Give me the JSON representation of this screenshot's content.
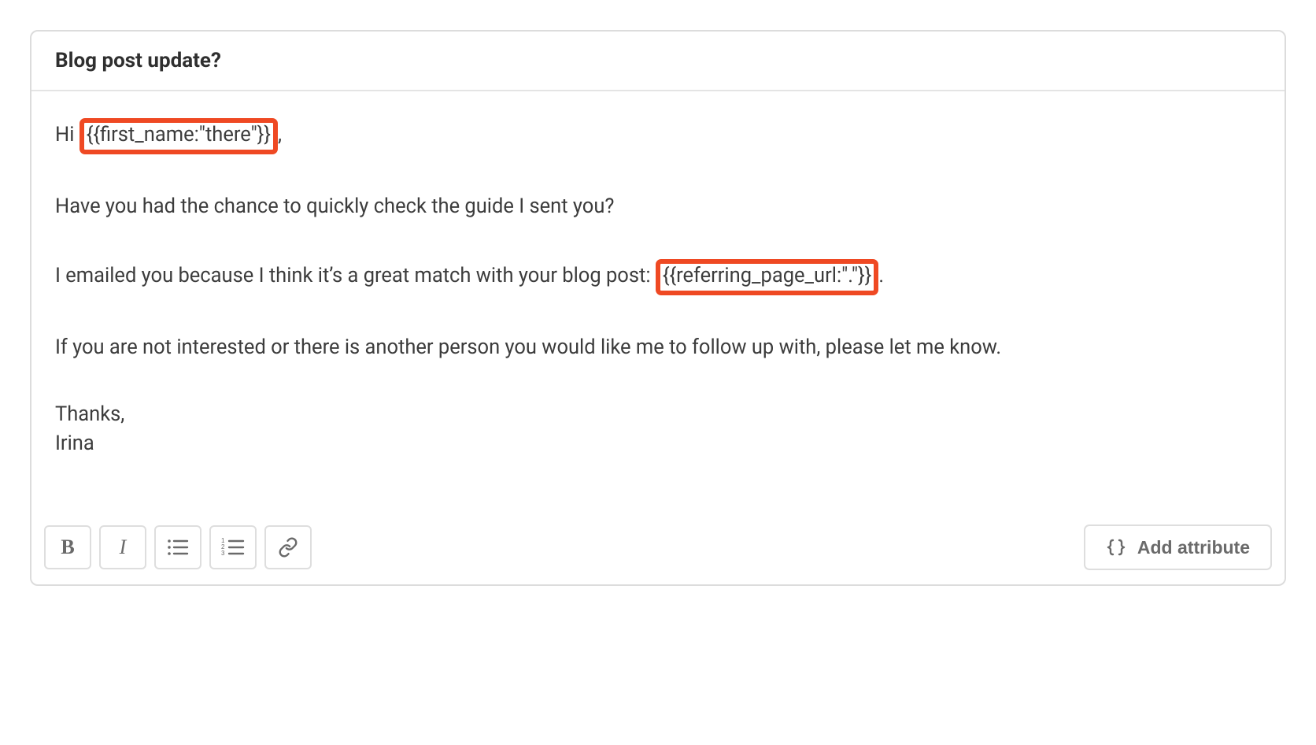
{
  "subject": "Blog post update?",
  "body": {
    "greeting_prefix": "Hi ",
    "greeting_attr": "{{first_name:\"there\"}}",
    "greeting_suffix": ",",
    "p2": "Have you had the chance to quickly check the guide I sent you?",
    "p3_prefix": "I emailed you because I think it’s a great match with your blog post: ",
    "p3_attr": "{{referring_page_url:\".\"}}",
    "p3_suffix": ".",
    "p4": "If you are not interested or there is another person you would like me to follow up with, please let me know.",
    "signoff": "Thanks,",
    "name": "Irina"
  },
  "toolbar": {
    "bold": "B",
    "italic": "I",
    "add_attribute": "Add attribute"
  }
}
